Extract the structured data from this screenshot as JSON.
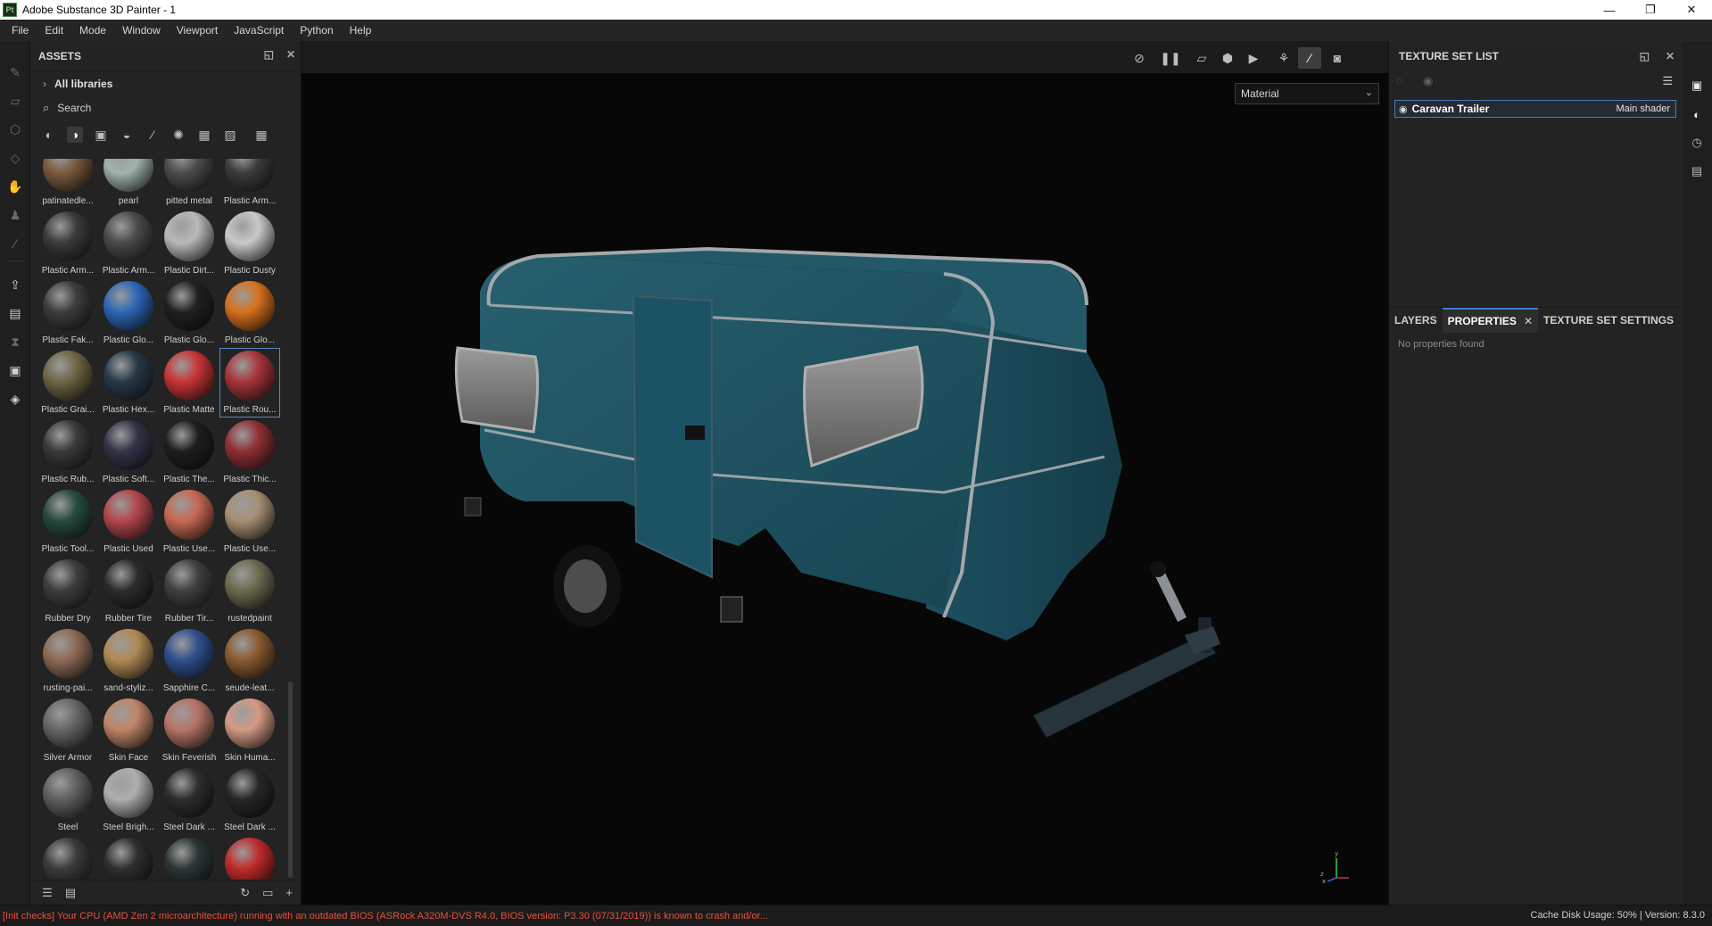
{
  "window": {
    "title": "Adobe Substance 3D Painter - 1",
    "app_icon_text": "Pt",
    "controls": {
      "minimize": "—",
      "restore": "❐",
      "close": "✕"
    }
  },
  "menubar": [
    "File",
    "Edit",
    "Mode",
    "Window",
    "Viewport",
    "JavaScript",
    "Python",
    "Help"
  ],
  "assets_panel": {
    "title": "ASSETS",
    "library_label": "All libraries",
    "search_placeholder": "Search",
    "assets": [
      {
        "label": "patinatedle...",
        "color": "#7a5a3e"
      },
      {
        "label": "pearl",
        "color": "#9fb3ad"
      },
      {
        "label": "pitted metal",
        "color": "#4b4b4b"
      },
      {
        "label": "Plastic Arm...",
        "color": "#3b3b3b"
      },
      {
        "label": "Plastic Arm...",
        "color": "#3a3a3a"
      },
      {
        "label": "Plastic Arm...",
        "color": "#4a4a4a"
      },
      {
        "label": "Plastic Dirt...",
        "color": "#b9b9b9"
      },
      {
        "label": "Plastic Dusty",
        "color": "#c9c9c9"
      },
      {
        "label": "Plastic Fak...",
        "color": "#3c3c3c"
      },
      {
        "label": "Plastic Glo...",
        "color": "#2c66b5"
      },
      {
        "label": "Plastic Glo...",
        "color": "#202020"
      },
      {
        "label": "Plastic Glo...",
        "color": "#d7711c"
      },
      {
        "label": "Plastic Grai...",
        "color": "#6e6544"
      },
      {
        "label": "Plastic Hex...",
        "color": "#263947"
      },
      {
        "label": "Plastic Matte",
        "color": "#c93434"
      },
      {
        "label": "Plastic Rou...",
        "color": "#a8343a",
        "selected": true
      },
      {
        "label": "Plastic Rub...",
        "color": "#3a3a3a"
      },
      {
        "label": "Plastic Soft...",
        "color": "#323447"
      },
      {
        "label": "Plastic The...",
        "color": "#1e1e1e"
      },
      {
        "label": "Plastic Thic...",
        "color": "#8f2f34"
      },
      {
        "label": "Plastic Tool...",
        "color": "#274a3d"
      },
      {
        "label": "Plastic Used",
        "color": "#b2464d"
      },
      {
        "label": "Plastic Use...",
        "color": "#c66752"
      },
      {
        "label": "Plastic Use...",
        "color": "#a69073"
      },
      {
        "label": "Rubber Dry",
        "color": "#3d3d3d"
      },
      {
        "label": "Rubber Tire",
        "color": "#2c2c2c"
      },
      {
        "label": "Rubber Tir...",
        "color": "#404040"
      },
      {
        "label": "rustedpaint",
        "color": "#6b6a4e"
      },
      {
        "label": "rusting-pai...",
        "color": "#8d6a55"
      },
      {
        "label": "sand-styliz...",
        "color": "#b08a55"
      },
      {
        "label": "Sapphire C...",
        "color": "#2f4f8e"
      },
      {
        "label": "seude-leat...",
        "color": "#8a5a2e"
      },
      {
        "label": "Silver Armor",
        "color": "#666666"
      },
      {
        "label": "Skin Face",
        "color": "#c08468"
      },
      {
        "label": "Skin Feverish",
        "color": "#b67468"
      },
      {
        "label": "Skin Huma...",
        "color": "#d49a84"
      },
      {
        "label": "Steel",
        "color": "#5f5f5f"
      },
      {
        "label": "Steel Brigh...",
        "color": "#aeaeae"
      },
      {
        "label": "Steel Dark ...",
        "color": "#2d2d2d"
      },
      {
        "label": "Steel Dark ...",
        "color": "#262626"
      },
      {
        "label": "",
        "color": "#3a3a3a"
      },
      {
        "label": "",
        "color": "#2e2e2e"
      },
      {
        "label": "",
        "color": "#2a3535"
      },
      {
        "label": "",
        "color": "#c02a2a"
      }
    ]
  },
  "viewport": {
    "material_mode": "Material",
    "axis": {
      "x": "x",
      "y": "y",
      "z": "z"
    }
  },
  "texture_set_list": {
    "title": "TEXTURE SET LIST",
    "item_name": "Caravan Trailer",
    "item_shader": "Main shader"
  },
  "properties_area": {
    "tabs": [
      "LAYERS",
      "PROPERTIES",
      "TEXTURE SET SETTINGS"
    ],
    "active_tab": "PROPERTIES",
    "empty_message": "No properties found"
  },
  "statusbar": {
    "warning": "[Init checks] Your CPU (AMD Zen 2 microarchitecture) running with an outdated BIOS (ASRock A320M-DVS R4.0, BIOS version: P3.30 (07/31/2019)) is known to crash and/or...",
    "cache_label": "Cache Disk Usage:",
    "cache_value": "50%",
    "version": "| Version: 8.3.0"
  },
  "colors": {
    "accent": "#3f7ed0",
    "warning": "#e6503d",
    "trailer_body": "#1f5566"
  }
}
